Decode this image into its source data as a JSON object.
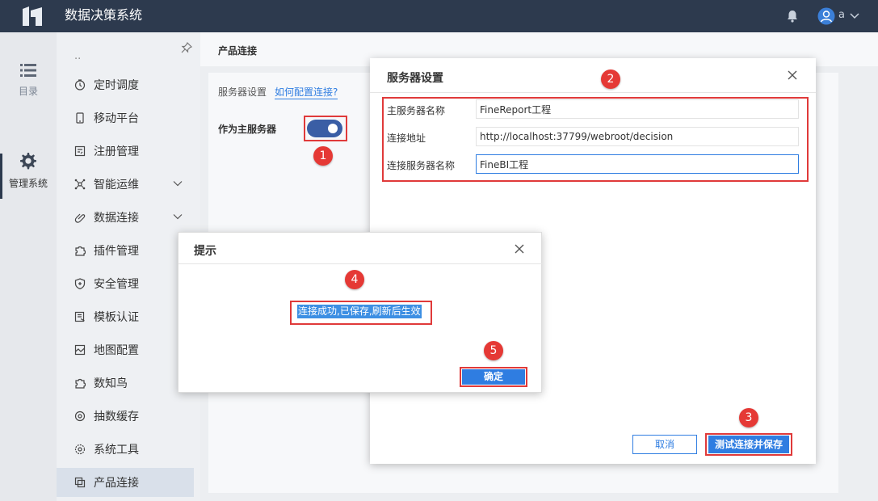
{
  "app": {
    "title": "数据决策系统",
    "user": "a"
  },
  "rail": {
    "items": [
      {
        "label": "目录",
        "icon": "list-icon"
      },
      {
        "label": "管理系统",
        "icon": "gear-icon"
      }
    ]
  },
  "sidebar": {
    "truncated": "..",
    "items": [
      {
        "label": "定时调度",
        "icon": "clock-icon"
      },
      {
        "label": "移动平台",
        "icon": "mobile-icon"
      },
      {
        "label": "注册管理",
        "icon": "register-icon"
      },
      {
        "label": "智能运维",
        "icon": "network-icon",
        "expandable": true
      },
      {
        "label": "数据连接",
        "icon": "link-icon",
        "expandable": true
      },
      {
        "label": "插件管理",
        "icon": "plugin-icon"
      },
      {
        "label": "安全管理",
        "icon": "shield-icon"
      },
      {
        "label": "模板认证",
        "icon": "template-icon"
      },
      {
        "label": "地图配置",
        "icon": "map-icon"
      },
      {
        "label": "数知鸟",
        "icon": "bird-icon"
      },
      {
        "label": "抽数缓存",
        "icon": "cache-icon"
      },
      {
        "label": "系统工具",
        "icon": "tools-icon"
      },
      {
        "label": "产品连接",
        "icon": "product-link-icon",
        "active": true
      }
    ]
  },
  "content": {
    "title": "产品连接",
    "server_settings_label": "服务器设置",
    "how_link": "如何配置连接?",
    "master_label": "作为主服务器",
    "master_enabled": true
  },
  "server_dialog": {
    "title": "服务器设置",
    "fields": [
      {
        "label": "主服务器名称",
        "value": "FineReport工程"
      },
      {
        "label": "连接地址",
        "value": "http://localhost:37799/webroot/decision"
      },
      {
        "label": "连接服务器名称",
        "value": "FineBI工程"
      }
    ],
    "cancel": "取消",
    "test_save": "测试连接并保存"
  },
  "tip_dialog": {
    "title": "提示",
    "message": "连接成功,已保存,刷新后生效",
    "ok": "确定"
  },
  "badges": [
    "1",
    "2",
    "3",
    "4",
    "5"
  ],
  "colors": {
    "topbar": "#2d3a4e",
    "accent": "#2f7de1",
    "highlight": "#e03a3a",
    "badge": "#e53935"
  }
}
